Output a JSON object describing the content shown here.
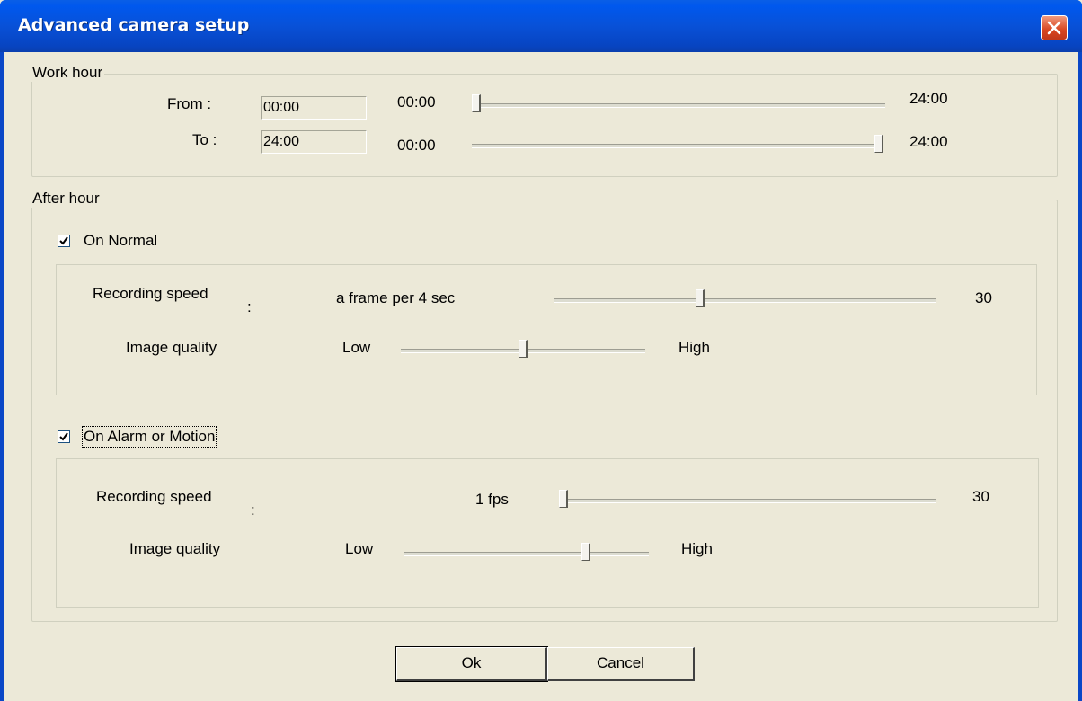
{
  "window": {
    "title": "Advanced camera setup"
  },
  "work_hour": {
    "label": "Work hour",
    "from": {
      "label": "From :",
      "value": "00:00",
      "slider_min": "00:00",
      "slider_max": "24:00",
      "slider_level": 0.0
    },
    "to": {
      "label": "To :",
      "value": "24:00",
      "slider_min": "00:00",
      "slider_max": "24:00",
      "slider_level": 1.0
    }
  },
  "after_hour": {
    "label": "After hour",
    "on_normal": {
      "label": "On Normal",
      "checked": true,
      "recording_speed": {
        "label": "Recording speed",
        "colon": ":",
        "value_text": "a frame per 4 sec",
        "max_label": "30",
        "slider_level": 0.38
      },
      "image_quality": {
        "label": "Image quality",
        "low": "Low",
        "high": "High",
        "slider_level": 0.5
      }
    },
    "on_alarm": {
      "label": "On Alarm or Motion",
      "checked": true,
      "recording_speed": {
        "label": "Recording speed",
        "colon": ":",
        "value_text": "1 fps",
        "max_label": "30",
        "slider_level": 0.0
      },
      "image_quality": {
        "label": "Image quality",
        "low": "Low",
        "high": "High",
        "slider_level": 0.75
      }
    }
  },
  "buttons": {
    "ok": "Ok",
    "cancel": "Cancel"
  },
  "icons": {
    "close": "close-icon",
    "check": "checkmark-icon"
  }
}
